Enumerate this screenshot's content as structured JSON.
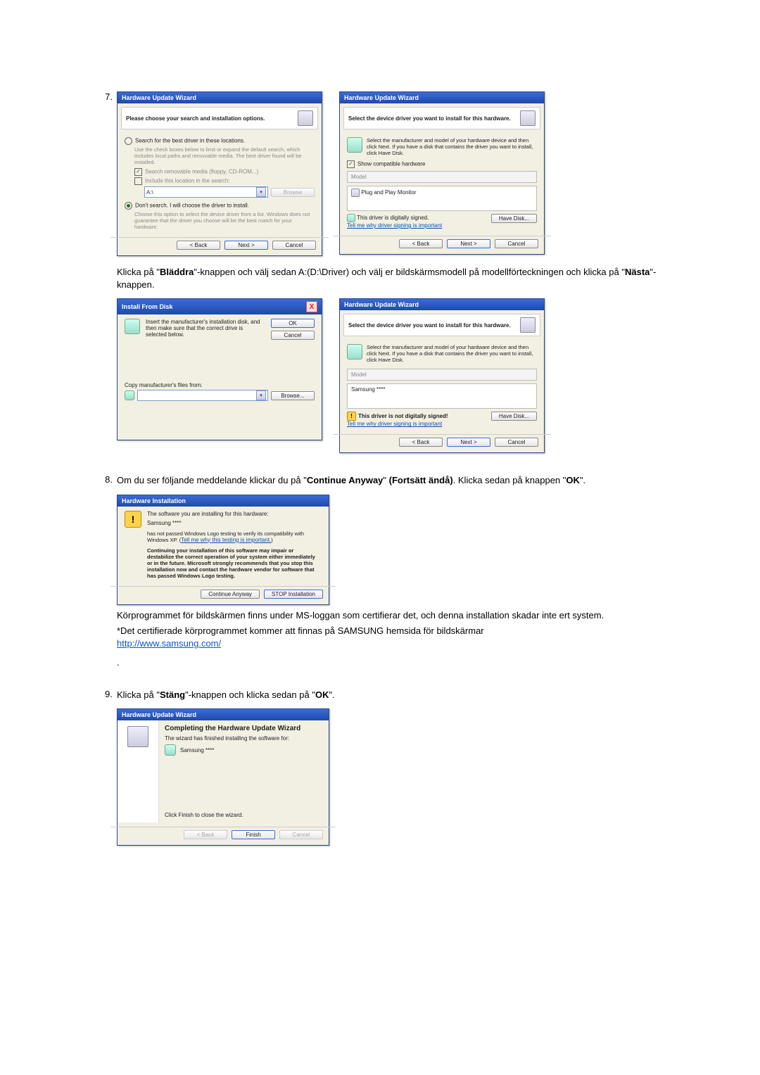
{
  "steps": {
    "s7": {
      "num": "7.",
      "text_a": "Klicka på \"",
      "bold_a": "Bläddra",
      "text_b": "\"-knappen och välj sedan A:(D:\\Driver) och välj er bildskärmsmodell på modellförteckningen och klicka på \"",
      "bold_b": "Nästa",
      "text_c": "\"-knappen."
    },
    "s8": {
      "num": "8.",
      "text_a": "Om du ser följande meddelande klickar du på \"",
      "bold_a": "Continue Anyway",
      "text_b": "\" ",
      "bold_b": "(Fortsätt ändå)",
      "text_c": ". Klicka sedan på knappen \"",
      "bold_c": "OK",
      "text_d": "\".",
      "footer1": "Körprogrammet för bildskärmen finns under MS-loggan som certifierar det, och denna installation skadar inte ert system.",
      "footer2": "*Det certifierade körprogrammet kommer att finnas på SAMSUNG hemsida för bildskärmar",
      "link": "http://www.samsung.com/"
    },
    "s9": {
      "num": "9.",
      "text_a": "Klicka på \"",
      "bold_a": "Stäng",
      "text_b": "\"-knappen och klicka sedan på \"",
      "bold_b": "OK",
      "text_c": "\"."
    }
  },
  "dlg_a1": {
    "title": "Hardware Update Wizard",
    "heading": "Please choose your search and installation options.",
    "opt1": "Search for the best driver in these locations.",
    "opt1_sub": "Use the check boxes below to limit or expand the default search, which includes local paths and removable media. The best driver found will be installed.",
    "chk1": "Search removable media (floppy, CD-ROM...)",
    "chk2": "Include this location in the search:",
    "path": "A:\\",
    "browse": "Browse",
    "opt2": "Don't search. I will choose the driver to install.",
    "opt2_sub": "Choose this option to select the device driver from a list. Windows does not guarantee that the driver you choose will be the best match for your hardware.",
    "back": "< Back",
    "next": "Next >",
    "cancel": "Cancel"
  },
  "dlg_a2": {
    "title": "Hardware Update Wizard",
    "heading": "Select the device driver you want to install for this hardware.",
    "info": "Select the manufacturer and model of your hardware device and then click Next. If you have a disk that contains the driver you want to install, click Have Disk.",
    "chk": "Show compatible hardware",
    "model_hdr": "Model",
    "model_val": "Plug and Play Monitor",
    "signed": "This driver is digitally signed.",
    "tell": "Tell me why driver signing is important",
    "havedisk": "Have Disk...",
    "back": "< Back",
    "next": "Next >",
    "cancel": "Cancel"
  },
  "dlg_b1": {
    "title": "Install From Disk",
    "msg": "Insert the manufacturer's installation disk, and then make sure that the correct drive is selected below.",
    "ok": "OK",
    "cancel": "Cancel",
    "copy": "Copy manufacturer's files from:",
    "path": "",
    "browse": "Browse..."
  },
  "dlg_b2": {
    "title": "Hardware Update Wizard",
    "heading": "Select the device driver you want to install for this hardware.",
    "info": "Select the manufacturer and model of your hardware device and then click Next. If you have a disk that contains the driver you want to install, click Have Disk.",
    "model_hdr": "Model",
    "model_val": "Samsung ****",
    "notsigned": "This driver is not digitally signed!",
    "tell": "Tell me why driver signing is important",
    "havedisk": "Have Disk...",
    "back": "< Back",
    "next": "Next >",
    "cancel": "Cancel"
  },
  "dlg_c": {
    "title": "Hardware Installation",
    "l1": "The software you are installing for this hardware:",
    "l2": "Samsung ****",
    "l3a": "has not passed Windows Logo testing to verify its compatibility with Windows XP. (",
    "l3link": "Tell me why this testing is important.",
    "l3b": ")",
    "bold": "Continuing your installation of this software may impair or destabilize the correct operation of your system either immediately or in the future. Microsoft strongly recommends that you stop this installation now and contact the hardware vendor for software that has passed Windows Logo testing.",
    "cont": "Continue Anyway",
    "stop": "STOP Installation"
  },
  "dlg_d": {
    "title": "Hardware Update Wizard",
    "h": "Completing the Hardware Update Wizard",
    "l1": "The wizard has finished installing the software for:",
    "l2": "Samsung ****",
    "close": "Click Finish to close the wizard.",
    "back": "< Back",
    "finish": "Finish",
    "cancel": "Cancel"
  }
}
